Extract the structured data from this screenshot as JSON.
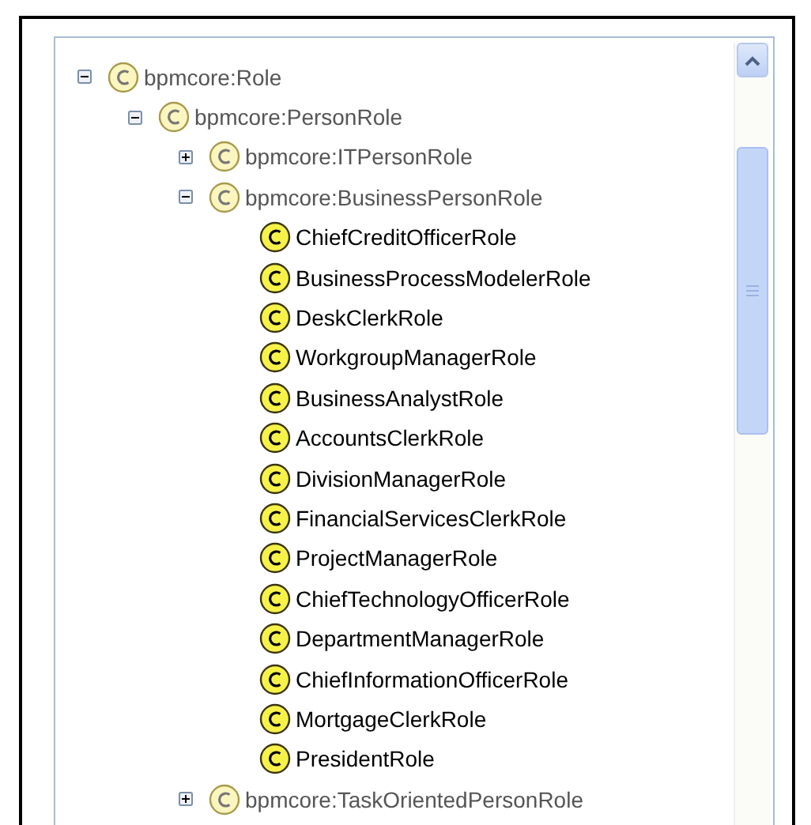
{
  "tree": [
    {
      "label": "bpmcore:Role",
      "disabled": true,
      "expanded": true,
      "children": [
        {
          "label": "bpmcore:PersonRole",
          "disabled": true,
          "expanded": true,
          "children": [
            {
              "label": "bpmcore:ITPersonRole",
              "disabled": true,
              "expanded": false
            },
            {
              "label": "bpmcore:BusinessPersonRole",
              "disabled": true,
              "expanded": true,
              "children": [
                {
                  "label": "ChiefCreditOfficerRole",
                  "disabled": false
                },
                {
                  "label": "BusinessProcessModelerRole",
                  "disabled": false
                },
                {
                  "label": "DeskClerkRole",
                  "disabled": false
                },
                {
                  "label": "WorkgroupManagerRole",
                  "disabled": false
                },
                {
                  "label": "BusinessAnalystRole",
                  "disabled": false
                },
                {
                  "label": "AccountsClerkRole",
                  "disabled": false
                },
                {
                  "label": "DivisionManagerRole",
                  "disabled": false
                },
                {
                  "label": "FinancialServicesClerkRole",
                  "disabled": false
                },
                {
                  "label": "ProjectManagerRole",
                  "disabled": false
                },
                {
                  "label": "ChiefTechnologyOfficerRole",
                  "disabled": false
                },
                {
                  "label": "DepartmentManagerRole",
                  "disabled": false
                },
                {
                  "label": "ChiefInformationOfficerRole",
                  "disabled": false
                },
                {
                  "label": "MortgageClerkRole",
                  "disabled": false
                },
                {
                  "label": "PresidentRole",
                  "disabled": false
                }
              ]
            },
            {
              "label": "bpmcore:TaskOrientedPersonRole",
              "disabled": true,
              "expanded": false
            }
          ]
        }
      ]
    }
  ]
}
